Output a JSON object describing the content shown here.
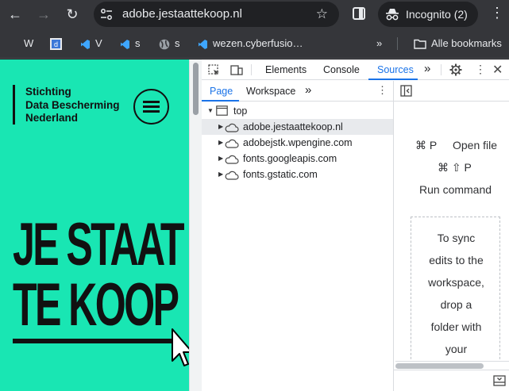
{
  "browser": {
    "url": "adobe.jestaattekoop.nl",
    "incognito_label": "Incognito (2)",
    "bookmarks": [
      {
        "label": "W",
        "icon": "wikipedia-icon"
      },
      {
        "label": "",
        "icon": "site-favicon-icon"
      },
      {
        "label": "V",
        "icon": "vscode-icon"
      },
      {
        "label": "s",
        "icon": "vscode-icon"
      },
      {
        "label": "s",
        "icon": "globe-icon"
      },
      {
        "label": "wezen.cyberfusio…",
        "icon": "vscode-icon"
      }
    ],
    "all_bookmarks": "Alle bookmarks",
    "overflow": "»"
  },
  "page": {
    "org_line1": "Stichting",
    "org_line2": "Data Bescherming",
    "org_line3": "Nederland",
    "headline_1": "JE STAAT",
    "headline_2": "TE KOOP",
    "brand_color": "#19e6b3"
  },
  "devtools": {
    "tabs": [
      "Elements",
      "Console",
      "Sources"
    ],
    "active_tab": "Sources",
    "overflow": "»",
    "sub_tabs": [
      "Page",
      "Workspace"
    ],
    "sub_overflow": "»",
    "tree": {
      "root": "top",
      "children": [
        "adobe.jestaattekoop.nl",
        "adobejstk.wpengine.com",
        "fonts.googleapis.com",
        "fonts.gstatic.com"
      ]
    },
    "shortcuts": {
      "open_file_keys": "⌘ P",
      "open_file_label": "Open file",
      "run_command_keys": "⌘ ⇧ P",
      "run_command_label": "Run command"
    },
    "drop_text": [
      "To sync",
      "edits to the",
      "workspace,",
      "drop a",
      "folder with",
      "your"
    ]
  }
}
